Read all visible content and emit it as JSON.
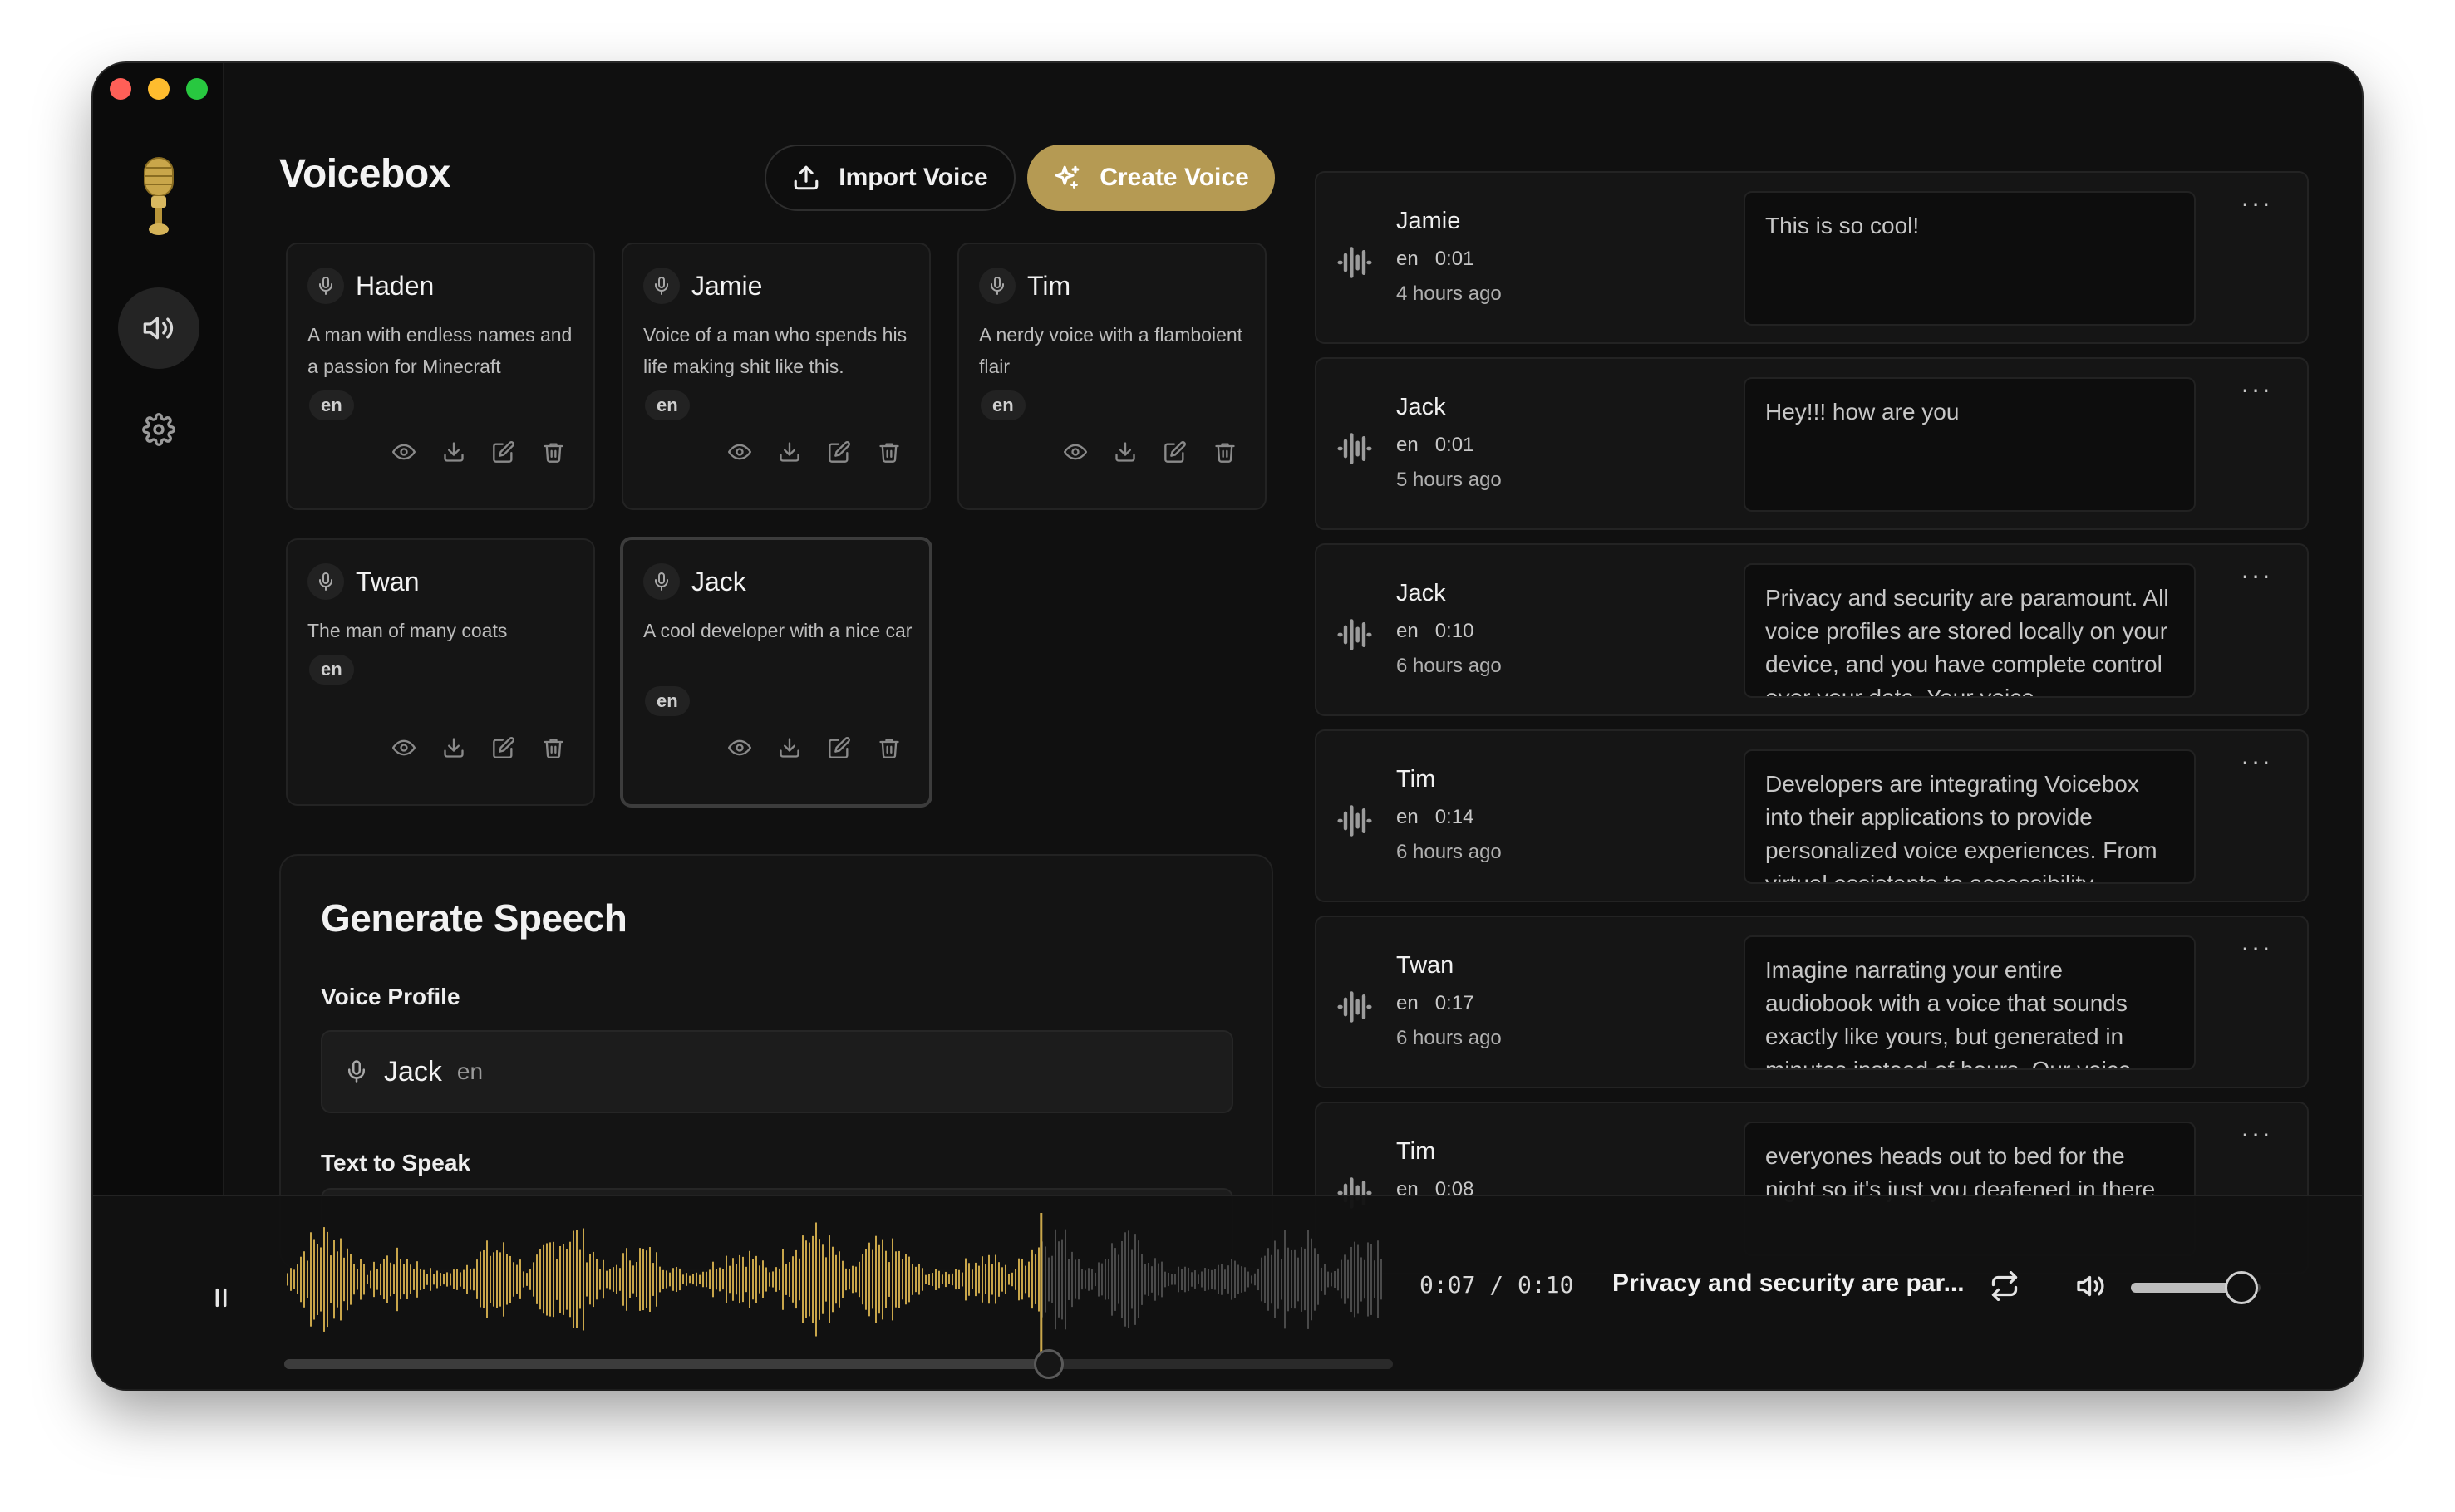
{
  "app": {
    "title": "Voicebox"
  },
  "header": {
    "import_label": "Import Voice",
    "create_label": "Create Voice"
  },
  "colors": {
    "accent": "#b59a53",
    "background": "#101010",
    "card": "#151515"
  },
  "voices": [
    {
      "name": "Haden",
      "description": "A man with endless names and a passion for Minecraft",
      "lang": "en"
    },
    {
      "name": "Jamie",
      "description": "Voice of a man who spends his life making shit like this.",
      "lang": "en"
    },
    {
      "name": "Tim",
      "description": "A nerdy voice with a flamboient flair",
      "lang": "en"
    },
    {
      "name": "Twan",
      "description": "The man of many coats",
      "lang": "en"
    },
    {
      "name": "Jack",
      "description": "A cool developer with a nice car",
      "lang": "en",
      "selected": true
    }
  ],
  "generate": {
    "title": "Generate Speech",
    "voice_profile_label": "Voice Profile",
    "selected_voice_name": "Jack",
    "selected_voice_lang": "en",
    "text_label": "Text to Speak"
  },
  "history": [
    {
      "name": "Jamie",
      "lang": "en",
      "duration": "0:01",
      "ago": "4 hours ago",
      "text": "This is so cool!"
    },
    {
      "name": "Jack",
      "lang": "en",
      "duration": "0:01",
      "ago": "5 hours ago",
      "text": "Hey!!! how are you"
    },
    {
      "name": "Jack",
      "lang": "en",
      "duration": "0:10",
      "ago": "6 hours ago",
      "text": "Privacy and security are paramount. All voice profiles are stored locally on your device, and you have complete control over your data. Your voice"
    },
    {
      "name": "Tim",
      "lang": "en",
      "duration": "0:14",
      "ago": "6 hours ago",
      "text": "Developers are integrating Voicebox into their applications to provide personalized voice experiences. From virtual assistants to accessibility"
    },
    {
      "name": "Twan",
      "lang": "en",
      "duration": "0:17",
      "ago": "6 hours ago",
      "text": "Imagine narrating your entire audiobook with a voice that sounds exactly like yours, but generated in minutes instead of hours. Our voice"
    },
    {
      "name": "Tim",
      "lang": "en",
      "duration": "0:08",
      "ago": "",
      "text": "everyones heads out to bed for the night so it's just you deafened in there"
    }
  ],
  "player": {
    "current_time": "0:07",
    "separator": "/",
    "total_time": "0:10",
    "title": "Privacy and security are par...",
    "progress": 0.69,
    "volume": 0.85
  }
}
